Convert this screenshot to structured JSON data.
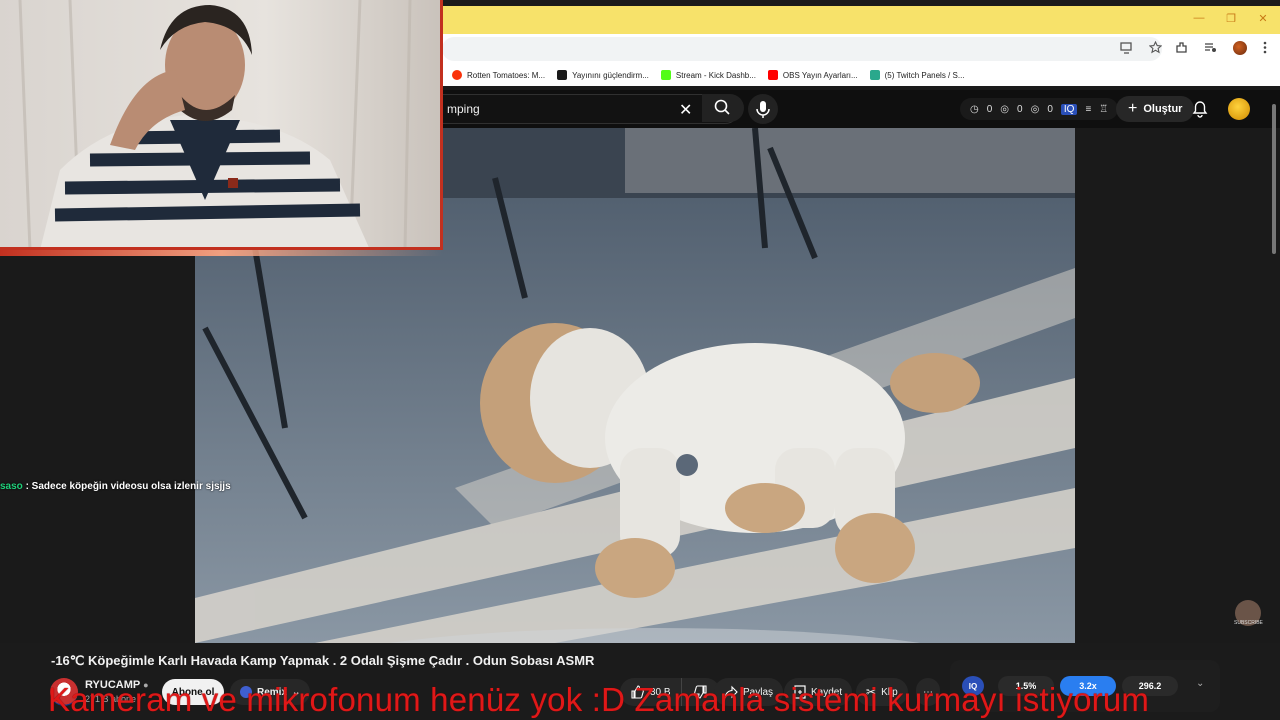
{
  "window": {
    "controls": [
      "—",
      "❐",
      "✕"
    ]
  },
  "bookmarks": [
    {
      "label": "Rotten Tomatoes: M...",
      "color": "#fa320a"
    },
    {
      "label": "Yayınını güçlendirm...",
      "color": "#1a1a1a"
    },
    {
      "label": "Stream - Kick Dashb...",
      "color": "#53fc18"
    },
    {
      "label": "OBS Yayın Ayarları...",
      "color": "#ff0000"
    },
    {
      "label": "(5) Twitch Panels / S...",
      "color": "#2aa88c"
    }
  ],
  "youtube": {
    "search_value": "mping",
    "header_stats": [
      "0",
      "0",
      "0"
    ],
    "create_label": "Oluştur"
  },
  "chat": {
    "user": "saso",
    "message": " : Sadece köpeğin videosu olsa izlenir sjsjjs"
  },
  "video": {
    "title": "-16℃ Köpeğimle Karlı Havada Kamp Yapmak . 2 Odalı Şişme Çadır . Odun Sobası ASMR",
    "channel_name": "RYUCAMP",
    "subscriber_text": "271 B abone",
    "subscribe_label": "Abone ol",
    "remix_label": "Remix",
    "like_count": "30 B",
    "share_label": "Paylaş",
    "save_label": "Kaydet",
    "clip_label": "Klip",
    "watermark_label": "SUBSCRIBE"
  },
  "stats_panel": {
    "iq_label": "IQ",
    "pills": [
      {
        "value": "1.5%",
        "color": "#2a2a2a"
      },
      {
        "value": "3.2x",
        "color": "#2a7ef0"
      },
      {
        "value": "296.2",
        "color": "#2a2a2a"
      }
    ]
  },
  "overlay": {
    "message": "Kameram ve mikrofonum henüz yok :D Zamanla sistemi kurmayı istiyorum"
  }
}
